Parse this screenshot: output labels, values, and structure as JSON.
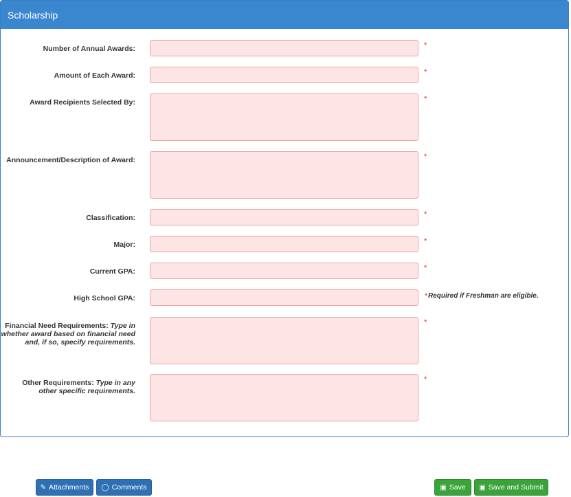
{
  "panel": {
    "title": "Scholarship"
  },
  "fields": {
    "annual_awards": {
      "label": "Number of Annual Awards:",
      "value": ""
    },
    "amount_each": {
      "label": "Amount of Each Award:",
      "value": ""
    },
    "recipients_selected_by": {
      "label": "Award Recipients Selected By:",
      "value": ""
    },
    "announcement": {
      "label": "Announcement/Description of Award:",
      "value": ""
    },
    "classification": {
      "label": "Classification:",
      "value": ""
    },
    "major": {
      "label": "Major:",
      "value": ""
    },
    "current_gpa": {
      "label": "Current GPA:",
      "value": ""
    },
    "high_school_gpa": {
      "label": "High School GPA:",
      "value": "",
      "note": "Required if Freshman are eligible."
    },
    "financial_need": {
      "label": "Financial Need Requirements:",
      "hint": "Type in whether award based on financial need and, if so, specify requirements.",
      "value": ""
    },
    "other_requirements": {
      "label": "Other Requirements:",
      "hint": "Type in any other specific requirements.",
      "value": ""
    }
  },
  "required_marker": "*",
  "buttons": {
    "attachments": "Attachments",
    "comments": "Comments",
    "save": "Save",
    "save_submit": "Save and Submit"
  },
  "colors": {
    "header": "#3a87d0",
    "required_bg": "#fde5e5",
    "primary_btn": "#2f6fb3",
    "success_btn": "#3aa33a"
  }
}
